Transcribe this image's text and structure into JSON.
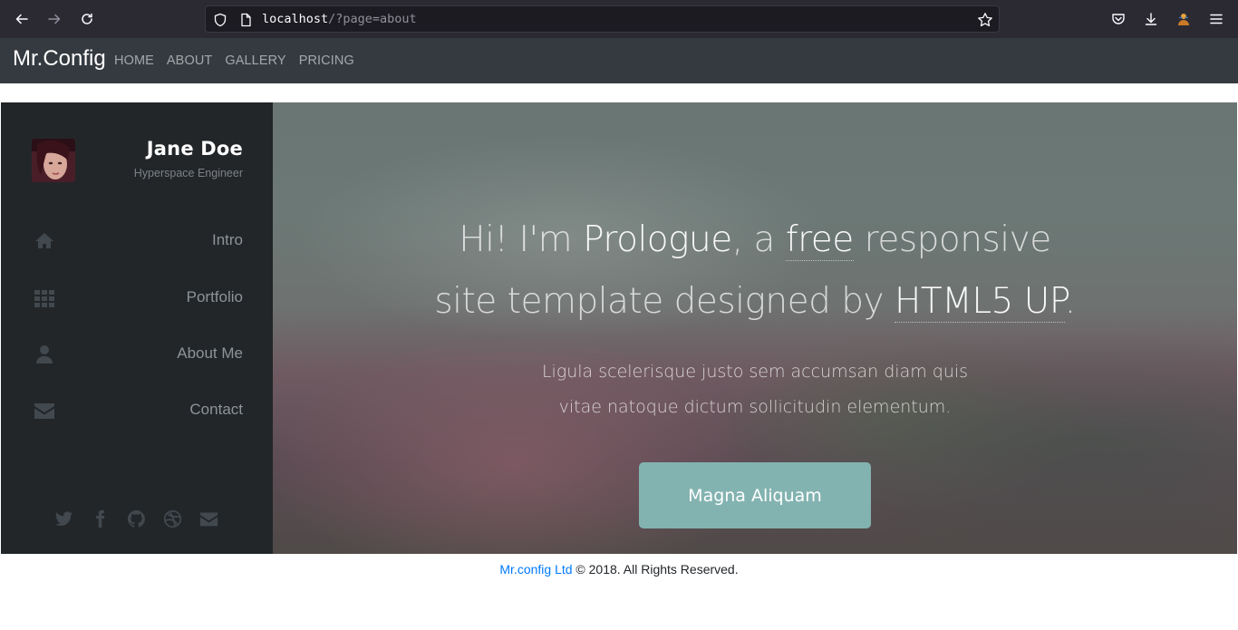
{
  "browser": {
    "url_host": "localhost",
    "url_path": "/?page=about"
  },
  "site": {
    "brand": "Mr.Config",
    "menu": [
      "HOME",
      "ABOUT",
      "GALLERY",
      "PRICING"
    ]
  },
  "profile": {
    "name": "Jane Doe",
    "role": "Hyperspace Engineer"
  },
  "sidebar": {
    "items": [
      {
        "label": "Intro",
        "icon": "home-icon"
      },
      {
        "label": "Portfolio",
        "icon": "grid-icon"
      },
      {
        "label": "About Me",
        "icon": "user-icon"
      },
      {
        "label": "Contact",
        "icon": "envelope-icon"
      }
    ],
    "socials": [
      "twitter-icon",
      "facebook-icon",
      "github-icon",
      "dribbble-icon",
      "envelope-icon"
    ]
  },
  "hero": {
    "title_1": "Hi! I'm ",
    "title_2": "Prologue",
    "title_3": ", a ",
    "title_4": "free",
    "title_5": " responsive",
    "title_6": "site template designed by ",
    "title_7": "HTML5 UP",
    "title_8": ".",
    "subtitle_line1": "Ligula scelerisque justo sem accumsan diam quis",
    "subtitle_line2": "vitae natoque dictum sollicitudin elementum.",
    "button": "Magna Aliquam"
  },
  "footer": {
    "link": "Mr.config Ltd",
    "text": " © 2018. All Rights Reserved."
  },
  "colors": {
    "sidebar_bg": "#222629",
    "navbar_bg": "#343a40",
    "button_bg": "#83b3b0",
    "footer_link": "#007bff"
  }
}
